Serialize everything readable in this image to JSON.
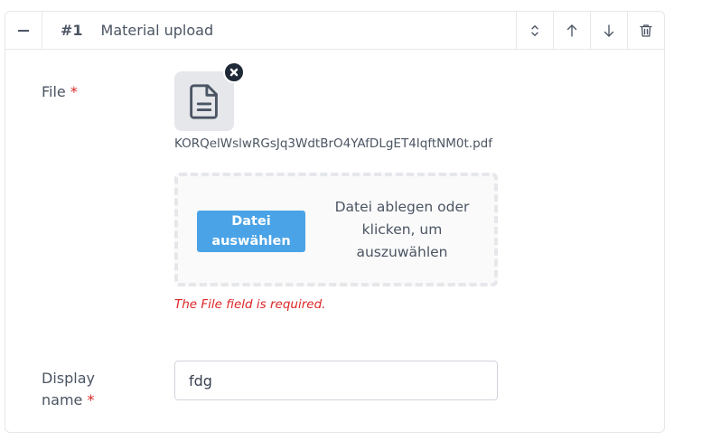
{
  "item": {
    "number": "#1",
    "title": "Material upload"
  },
  "actions": {
    "collapse_icon": "minus-icon",
    "sort_icon": "chevron-up-down-icon",
    "up_icon": "arrow-up-icon",
    "down_icon": "arrow-down-icon",
    "delete_icon": "trash-icon"
  },
  "file_field": {
    "label": "File",
    "required_mark": "*",
    "file_icon": "document-icon",
    "remove_icon": "close-icon",
    "file_name": "KORQelWslwRGsJq3WdtBrO4YAfDLgET4IqftNM0t.pdf",
    "choose_button": "Datei auswählen",
    "drop_text": "Datei ablegen oder klicken, um auszuwählen",
    "error": "The File field is required."
  },
  "display_name_field": {
    "label": "Display name",
    "required_mark": "*",
    "value": "fdg"
  },
  "colors": {
    "accent": "#4aa3e6",
    "error": "#dc2626",
    "border": "#e5e7eb"
  }
}
